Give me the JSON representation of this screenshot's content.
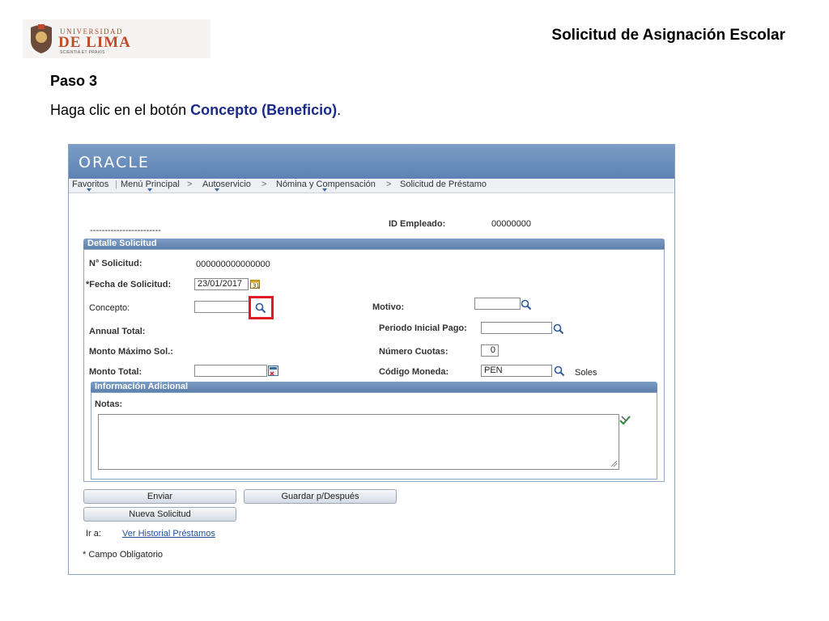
{
  "slide": {
    "logo": {
      "line1": "UNIVERSIDAD",
      "line2": "DE LIMA",
      "motto": "SCIENTIA ET PRAXIS"
    },
    "title": "Solicitud de Asignación Escolar",
    "step": "Paso 3",
    "instruction_prefix": "Haga clic en el botón ",
    "instruction_bold": "Concepto (Beneficio)",
    "instruction_suffix": "."
  },
  "app": {
    "brand": "ORACLE",
    "nav": [
      "Favoritos",
      "Menú Principal",
      "Autoservicio",
      "Nómina y Compensación",
      "Solicitud de Préstamo"
    ],
    "nav_sep": ">",
    "header": {
      "dashes": "------------------------",
      "id_label": "ID Empleado:",
      "id_value": "00000000"
    },
    "detail": {
      "section_title": "Detalle Solicitud",
      "nro_label": "N° Solicitud:",
      "nro_value": "000000000000000",
      "fecha_label": "*Fecha de Solicitud:",
      "fecha_value": "23/01/2017",
      "concepto_label": "Concepto:",
      "concepto_value": "",
      "motivo_label": "Motivo:",
      "motivo_value": "",
      "annual_label": "Annual Total:",
      "periodo_label": "Periodo Inicial Pago:",
      "periodo_value": "",
      "monto_max_label": "Monto Máximo Sol.:",
      "cuotas_label": "Número Cuotas:",
      "cuotas_value": "0",
      "monto_total_label": "Monto Total:",
      "monto_total_value": "",
      "moneda_label": "Código Moneda:",
      "moneda_value": "PEN",
      "moneda_desc": "Soles"
    },
    "info": {
      "section_title": "Información Adicional",
      "notas_label": "Notas:",
      "notas_value": ""
    },
    "buttons": {
      "enviar": "Enviar",
      "guardar": "Guardar p/Después",
      "nueva": "Nueva Solicitud"
    },
    "footer": {
      "ir_a": "Ir a:",
      "historial_link": "Ver Historial Préstamos",
      "required_note": "* Campo Obligatorio"
    }
  },
  "colors": {
    "highlight": "#e01b24",
    "instruction_bold": "#1a2a8a",
    "header_bar": "#5c83b3"
  }
}
